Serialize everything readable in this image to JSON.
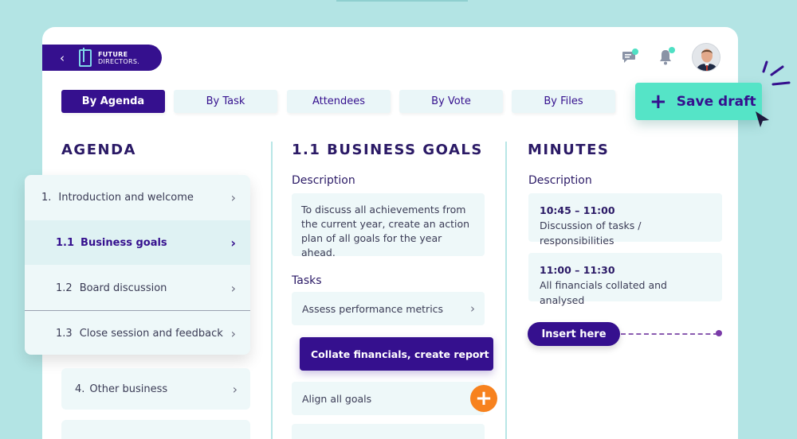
{
  "brand": {
    "line1": "FUTURE",
    "line2": "DIRECTORS."
  },
  "header": {
    "back_icon": "chevron-left-icon",
    "message_icon": "message-icon",
    "bell_icon": "bell-icon"
  },
  "tabs": [
    {
      "label": "By Agenda",
      "active": true
    },
    {
      "label": "By Task",
      "active": false
    },
    {
      "label": "Attendees",
      "active": false
    },
    {
      "label": "By Vote",
      "active": false
    },
    {
      "label": "By Files",
      "active": false
    }
  ],
  "save_draft": {
    "label": "Save draft"
  },
  "agenda": {
    "title": "AGENDA",
    "items": [
      {
        "num": "1.",
        "label": "Introduction and welcome"
      },
      {
        "num": "1.1",
        "label": "Business goals",
        "active": true
      },
      {
        "num": "1.2",
        "label": "Board discussion"
      },
      {
        "num": "1.3",
        "label": "Close session and feedback"
      }
    ],
    "other": {
      "num": "4.",
      "label": "Other business"
    }
  },
  "goals": {
    "title": "1.1 BUSINESS GOALS",
    "description_label": "Description",
    "description": "To discuss all achievements from the current year, create an action plan of all goals for the year ahead.",
    "tasks_label": "Tasks",
    "tasks": [
      "Assess performance metrics",
      "Collate financials, create report",
      "Align all goals"
    ]
  },
  "minutes": {
    "title": "MINUTES",
    "description_label": "Description",
    "entries": [
      {
        "time": "10:45 – 11:00",
        "text": "Discussion of tasks / responsibilities"
      },
      {
        "time": "11:00 – 11:30",
        "text": "All financials collated and analysed"
      }
    ],
    "insert_label": "Insert here"
  },
  "colors": {
    "primary": "#35108e",
    "accent": "#55e4c7",
    "orange": "#f7821e",
    "background": "#b3e4e4"
  }
}
